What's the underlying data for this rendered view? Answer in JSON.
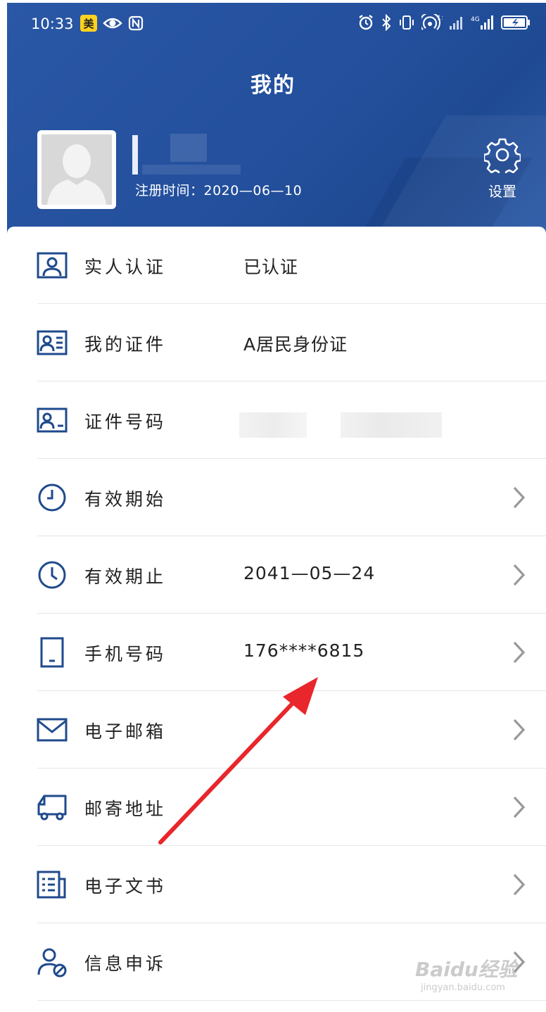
{
  "status_bar": {
    "time": "10:33",
    "app_badge": "美",
    "icons": [
      "eye-icon",
      "nfc-icon",
      "alarm-icon",
      "bluetooth-icon",
      "vibrate-icon",
      "hotspot-icon",
      "signal-icon",
      "signal-4g-icon",
      "battery-charging-icon"
    ]
  },
  "header": {
    "title": "我的",
    "register_date": "注册时间：2020—06—10",
    "settings_label": "设置"
  },
  "list": {
    "items": [
      {
        "label": "实人认证",
        "value": "已认证",
        "icon": "person-verify-icon",
        "chevron": false
      },
      {
        "label": "我的证件",
        "value": "A居民身份证",
        "icon": "id-card-icon",
        "chevron": false
      },
      {
        "label": "证件号码",
        "value": "",
        "icon": "id-number-icon",
        "chevron": false
      },
      {
        "label": "有效期始",
        "value": "",
        "icon": "clock-start-icon",
        "chevron": true
      },
      {
        "label": "有效期止",
        "value": "2041—05—24",
        "icon": "clock-end-icon",
        "chevron": true
      },
      {
        "label": "手机号码",
        "value": "176****6815",
        "icon": "phone-icon",
        "chevron": true
      },
      {
        "label": "电子邮箱",
        "value": "",
        "icon": "mail-icon",
        "chevron": true
      },
      {
        "label": "邮寄地址",
        "value": "",
        "icon": "delivery-truck-icon",
        "chevron": true
      },
      {
        "label": "电子文书",
        "value": "",
        "icon": "document-icon",
        "chevron": true
      },
      {
        "label": "信息申诉",
        "value": "",
        "icon": "user-appeal-icon",
        "chevron": true
      }
    ]
  },
  "watermark": {
    "main": "Baidu经验",
    "sub": "jingyan.baidu.com"
  },
  "colors": {
    "header_bg": "#2a57a6",
    "icon_blue": "#1f4a8c",
    "arrow_red": "#e8262b"
  }
}
